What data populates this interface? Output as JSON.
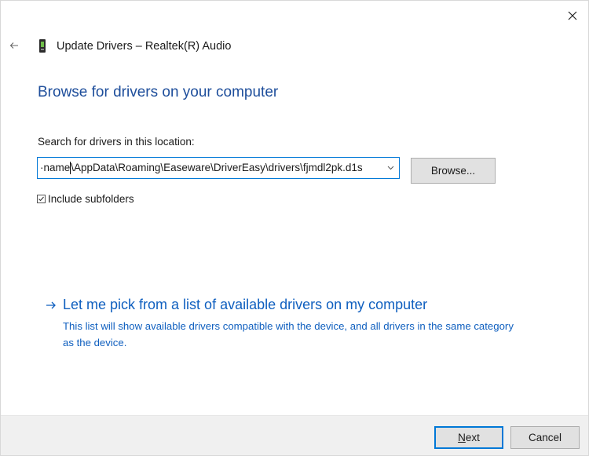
{
  "window": {
    "title": "Update Drivers – Realtek(R) Audio",
    "close_icon": "close-icon",
    "back_icon": "back-arrow-icon",
    "device_icon": "device-icon"
  },
  "main": {
    "heading": "Browse for drivers on your computer",
    "search_label": "Search for drivers in this location:",
    "path_before_caret": "·name",
    "path_after_caret": "\\AppData\\Roaming\\Easeware\\DriverEasy\\drivers\\fjmdl2pk.d1s",
    "browse_label": "Browse...",
    "include_subfolders": {
      "label": "Include subfolders",
      "checked": true
    },
    "pick_link": {
      "label": "Let me pick from a list of available drivers on my computer",
      "description": "This list will show available drivers compatible with the device, and all drivers in the same category as the device."
    }
  },
  "footer": {
    "next_label": "Next",
    "next_mnemonic": "N",
    "next_rest": "ext",
    "cancel_label": "Cancel"
  },
  "colors": {
    "heading": "#1e4e9b",
    "link": "#0f5fbf",
    "focus_border": "#0078d7",
    "button_bg": "#e1e1e1",
    "footer_bg": "#f0f0f0"
  }
}
